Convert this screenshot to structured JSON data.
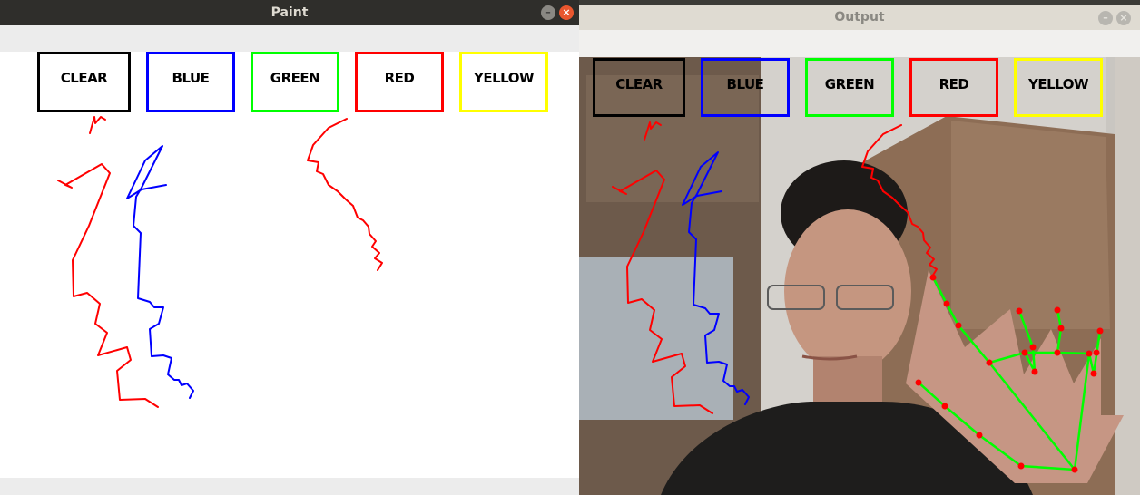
{
  "paint_window": {
    "title": "Paint",
    "buttons": [
      {
        "label": "CLEAR",
        "color": "#000000"
      },
      {
        "label": "BLUE",
        "color": "#0000ff"
      },
      {
        "label": "GREEN",
        "color": "#00ff00"
      },
      {
        "label": "RED",
        "color": "#ff0000"
      },
      {
        "label": "YELLOW",
        "color": "#ffff00"
      }
    ]
  },
  "output_window": {
    "title": "Output",
    "buttons": [
      {
        "label": "CLEAR",
        "color": "#000000"
      },
      {
        "label": "BLUE",
        "color": "#0000ff"
      },
      {
        "label": "GREEN",
        "color": "#00ff00"
      },
      {
        "label": "RED",
        "color": "#ff0000"
      },
      {
        "label": "YELLOW",
        "color": "#ffff00"
      }
    ]
  },
  "icons": {
    "minimize": "minimize-icon",
    "close": "close-icon"
  }
}
